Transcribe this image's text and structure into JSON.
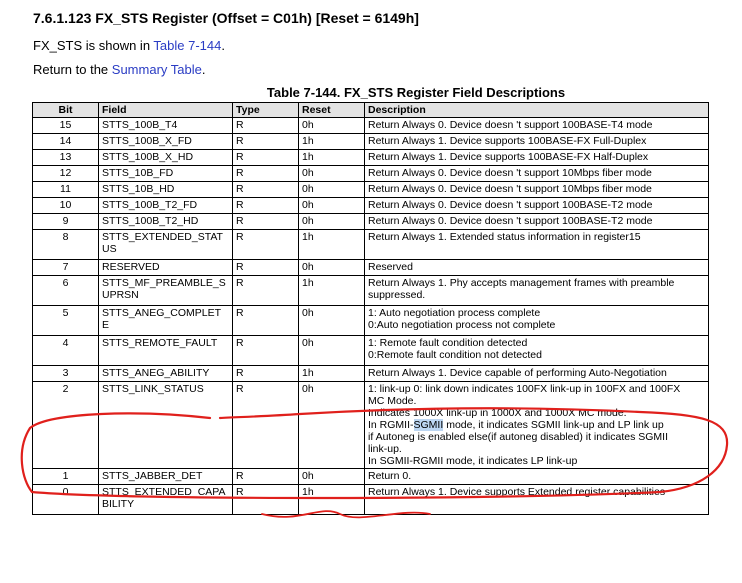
{
  "heading": "7.6.1.123 FX_STS Register (Offset = C01h) [Reset = 6149h]",
  "intro": {
    "prefix": "FX_STS is shown in ",
    "link": "Table 7-144",
    "suffix": "."
  },
  "return_line": {
    "prefix": "Return to the ",
    "link": "Summary Table",
    "suffix": "."
  },
  "table": {
    "caption": "Table 7-144. FX_STS Register Field Descriptions",
    "headers": {
      "bit": "Bit",
      "field": "Field",
      "type": "Type",
      "reset": "Reset",
      "description": "Description"
    },
    "rows": [
      {
        "bit": "15",
        "field": "STTS_100B_T4",
        "type": "R",
        "reset": "0h",
        "desc": [
          "Return Always 0. Device doesn 't support 100BASE-T4 mode"
        ]
      },
      {
        "bit": "14",
        "field": "STTS_100B_X_FD",
        "type": "R",
        "reset": "1h",
        "desc": [
          "Return Always 1. Device supports 100BASE-FX Full-Duplex"
        ]
      },
      {
        "bit": "13",
        "field": "STTS_100B_X_HD",
        "type": "R",
        "reset": "1h",
        "desc": [
          "Return Always 1. Device supports 100BASE-FX Half-Duplex"
        ]
      },
      {
        "bit": "12",
        "field": "STTS_10B_FD",
        "type": "R",
        "reset": "0h",
        "desc": [
          "Return Always 0. Device doesn 't support 10Mbps fiber mode"
        ]
      },
      {
        "bit": "11",
        "field": "STTS_10B_HD",
        "type": "R",
        "reset": "0h",
        "desc": [
          "Return Always 0. Device doesn 't support 10Mbps fiber mode"
        ]
      },
      {
        "bit": "10",
        "field": "STTS_100B_T2_FD",
        "type": "R",
        "reset": "0h",
        "desc": [
          "Return Always 0. Device doesn 't support 100BASE-T2 mode"
        ]
      },
      {
        "bit": "9",
        "field": "STTS_100B_T2_HD",
        "type": "R",
        "reset": "0h",
        "desc": [
          "Return Always 0. Device doesn 't support 100BASE-T2 mode"
        ]
      },
      {
        "bit": "8",
        "field": "STTS_EXTENDED_STAT\nUS",
        "type": "R",
        "reset": "1h",
        "desc": [
          "Return Always 1. Extended status information in register15"
        ]
      },
      {
        "bit": "7",
        "field": "RESERVED",
        "type": "R",
        "reset": "0h",
        "desc": [
          "Reserved"
        ]
      },
      {
        "bit": "6",
        "field": "STTS_MF_PREAMBLE_S\nUPRSN",
        "type": "R",
        "reset": "1h",
        "desc": [
          "Return Always 1. Phy accepts management frames with preamble",
          "suppressed."
        ]
      },
      {
        "bit": "5",
        "field": "STTS_ANEG_COMPLET\nE",
        "type": "R",
        "reset": "0h",
        "desc": [
          "1: Auto negotiation process complete",
          "0:Auto negotiation process not complete"
        ]
      },
      {
        "bit": "4",
        "field": "STTS_REMOTE_FAULT",
        "type": "R",
        "reset": "0h",
        "desc": [
          "1: Remote fault condition detected",
          "0:Remote fault condition not detected"
        ]
      },
      {
        "bit": "3",
        "field": "STTS_ANEG_ABILITY",
        "type": "R",
        "reset": "1h",
        "desc": [
          "Return Always 1. Device capable of performing Auto-Negotiation"
        ]
      },
      {
        "bit": "2",
        "field": "STTS_LINK_STATUS",
        "type": "R",
        "reset": "0h",
        "desc": [
          "1: link-up 0: link down indicates 100FX link-up in 100FX and 100FX",
          "MC Mode.",
          "Indicates 1000X link-up in 1000X and 1000X MC mode.",
          "In RGMII-|SGMII| mode, it indicates SGMII link-up and LP link up",
          "if Autoneg is enabled else(if autoneg disabled) it indicates SGMII",
          "link-up.",
          "In SGMII-RGMII mode, it indicates LP link-up"
        ]
      },
      {
        "bit": "1",
        "field": "STTS_JABBER_DET",
        "type": "R",
        "reset": "0h",
        "desc": [
          "Return 0."
        ]
      },
      {
        "bit": "0",
        "field": "STTS_EXTENDED_CAPA\nBILITY",
        "type": "R",
        "reset": "1h",
        "desc": [
          "Return Always 1. Device supports Extended register capabilities"
        ]
      }
    ]
  },
  "colors": {
    "link": "#2a3cc4",
    "header_bg": "#e3e3e3",
    "selection": "#bcd6f2",
    "annotation": "#e0201c"
  }
}
